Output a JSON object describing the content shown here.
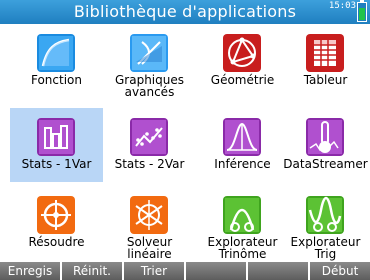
{
  "header": {
    "title": "Bibliothèque d'applications",
    "time": "15:03"
  },
  "apps": [
    {
      "label1": "Fonction",
      "label2": "",
      "icon": "function-icon",
      "color": "#1a8be0",
      "selected": false
    },
    {
      "label1": "Graphiques",
      "label2": "avancés",
      "icon": "advanced-graphing-icon",
      "color": "#2a9af0",
      "selected": false
    },
    {
      "label1": "Géométrie",
      "label2": "",
      "icon": "geometry-icon",
      "color": "#c81e1e",
      "selected": false
    },
    {
      "label1": "Tableur",
      "label2": "",
      "icon": "spreadsheet-icon",
      "color": "#c81e1e",
      "selected": false
    },
    {
      "label1": "Stats - 1Var",
      "label2": "",
      "icon": "stats-1var-icon",
      "color": "#8a2aa8",
      "selected": true
    },
    {
      "label1": "Stats - 2Var",
      "label2": "",
      "icon": "stats-2var-icon",
      "color": "#8a2aa8",
      "selected": false
    },
    {
      "label1": "Inférence",
      "label2": "",
      "icon": "inference-icon",
      "color": "#8a2aa8",
      "selected": false
    },
    {
      "label1": "DataStreamer",
      "label2": "",
      "icon": "datastreamer-icon",
      "color": "#8a2aa8",
      "selected": false
    },
    {
      "label1": "Résoudre",
      "label2": "",
      "icon": "solve-icon",
      "color": "#f26a10",
      "selected": false
    },
    {
      "label1": "Solveur",
      "label2": "linéaire",
      "icon": "linear-solver-icon",
      "color": "#f26a10",
      "selected": false
    },
    {
      "label1": "Explorateur",
      "label2": "Trinôme",
      "icon": "quadratic-explorer-icon",
      "color": "#3fa41e",
      "selected": false
    },
    {
      "label1": "Explorateur",
      "label2": "Trig",
      "icon": "trig-explorer-icon",
      "color": "#3fa41e",
      "selected": false
    }
  ],
  "softkeys": [
    "Enregis",
    "Réinit.",
    "Trier",
    "",
    "",
    "Début"
  ],
  "colors": {
    "title_bar": "#1f7fc0",
    "selection": "#b9d6f6",
    "softkey": "#6e6e6e"
  }
}
